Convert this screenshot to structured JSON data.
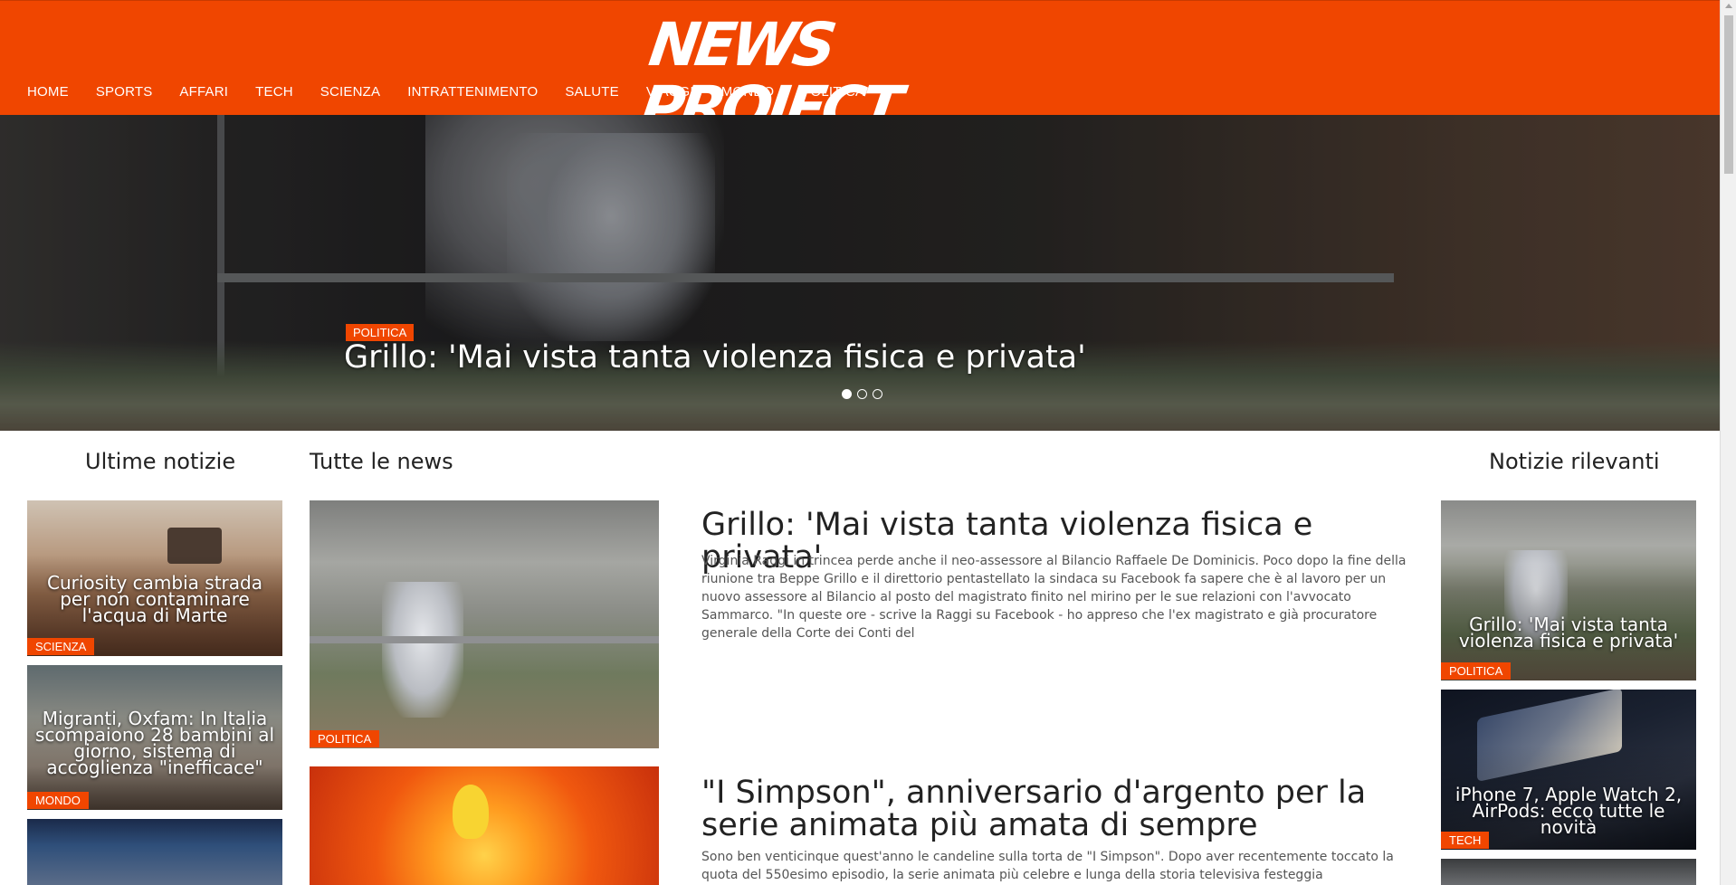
{
  "header": {
    "logo": "NEWS PROJECT",
    "nav": [
      "HOME",
      "SPORTS",
      "AFFARI",
      "TECH",
      "SCIENZA",
      "INTRATTENIMENTO",
      "SALUTE",
      "VIAGGI",
      "MONDO",
      "POLITICA"
    ]
  },
  "hero": {
    "badge": "POLITICA",
    "title": "Grillo: 'Mai vista tanta violenza fisica e privata'",
    "slides": 3,
    "active_slide": 1
  },
  "sections": {
    "latest": "Ultime notizie",
    "all": "Tutte le news",
    "relevant": "Notizie rilevanti"
  },
  "latest_news": [
    {
      "caption": "Curiosity cambia strada per non contaminare l'acqua di Marte",
      "tag": "SCIENZA"
    },
    {
      "caption": "Migranti, Oxfam: In Italia scompaiono 28 bambini al giorno, sistema di accoglienza \"inefficace\"",
      "tag": "MONDO"
    },
    {
      "caption": "",
      "tag": ""
    }
  ],
  "all_news": [
    {
      "tag": "POLITICA",
      "title": "Grillo: 'Mai vista tanta violenza fisica e privata'",
      "text": "Virginia Raggi in trincea perde anche il neo-assessore al Bilancio Raffaele De Dominicis. Poco dopo la fine della riunione tra Beppe Grillo e il direttorio pentastellato la sindaca su Facebook fa sapere che è al lavoro per un nuovo assessore al Bilancio al posto del magistrato finito nel mirino per le sue relazioni con l'avvocato Sammarco. \"In queste ore - scrive la Raggi su Facebook - ho appreso che l'ex magistrato e già procuratore generale della Corte dei Conti del"
    },
    {
      "tag": "",
      "title": "\"I Simpson\", anniversario d'argento per la serie animata più amata di sempre",
      "text": "Sono ben venticinque quest'anno le candeline sulla torta de \"I Simpson\". Dopo aver recentemente toccato la quota del 550esimo episodio, la serie animata più celebre e lunga della storia televisiva festeggia l'anniversario d'argento."
    }
  ],
  "relevant_news": [
    {
      "caption": "Grillo: 'Mai vista tanta violenza fisica e privata'",
      "tag": "POLITICA"
    },
    {
      "caption": "iPhone 7, Apple Watch 2, AirPods: ecco tutte le novità",
      "tag": "TECH"
    },
    {
      "caption": "",
      "tag": ""
    }
  ],
  "colors": {
    "accent": "#f04600"
  }
}
